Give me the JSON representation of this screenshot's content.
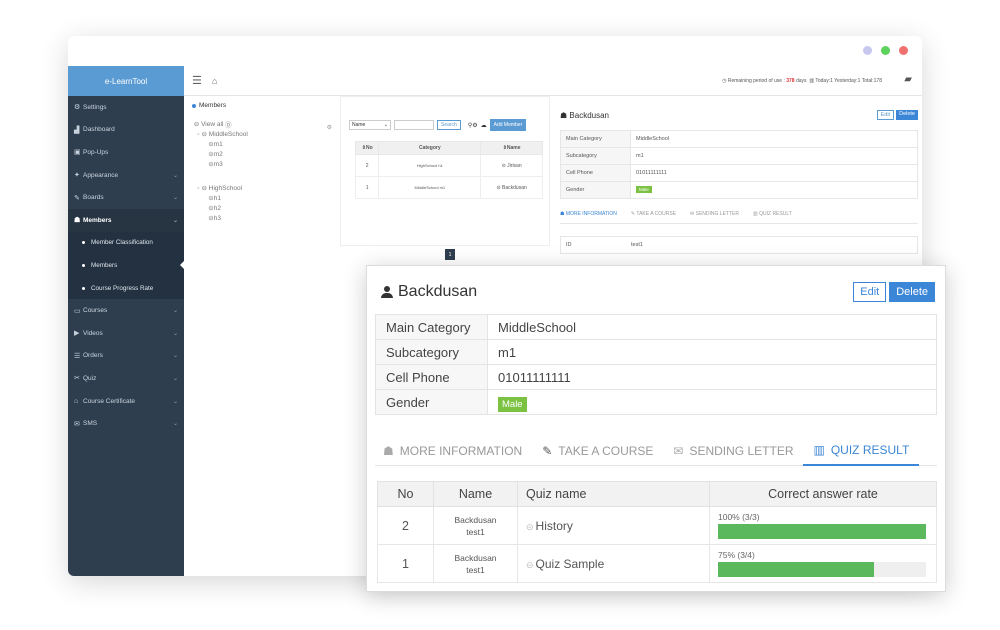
{
  "app": {
    "logo": "e-LearnTool"
  },
  "window_controls": {
    "colors": [
      "#c7c7f0",
      "#5cd15c",
      "#f07070"
    ]
  },
  "topbar": {
    "usage_prefix": "Remaining period of use :",
    "usage_days": "378",
    "usage_suffix": "days",
    "stats": "Today:1  Yesterday:1  Total:178"
  },
  "sidebar": {
    "items": [
      {
        "label": "Settings",
        "icon": "⚙"
      },
      {
        "label": "Dashboard",
        "icon": "▟"
      },
      {
        "label": "Pop-Ups",
        "icon": "▣"
      },
      {
        "label": "Appearance",
        "icon": "✦"
      },
      {
        "label": "Boards",
        "icon": "✎"
      },
      {
        "label": "Members",
        "icon": "☗"
      }
    ],
    "member_sub": [
      "Member Classification",
      "Members",
      "Course Progress Rate"
    ],
    "items2": [
      {
        "label": "Courses",
        "icon": "▭"
      },
      {
        "label": "Videos",
        "icon": "▶"
      },
      {
        "label": "Orders",
        "icon": "☰"
      },
      {
        "label": "Quiz",
        "icon": "✂"
      },
      {
        "label": "Course Certificate",
        "icon": "⌂"
      },
      {
        "label": "SMS",
        "icon": "✉"
      }
    ]
  },
  "tree": {
    "title": "Members",
    "view_all": "View all",
    "groups": [
      {
        "name": "MiddleSchool",
        "children": [
          "m1",
          "m2",
          "m3"
        ]
      },
      {
        "name": "HighSchool",
        "children": [
          "h1",
          "h2",
          "h3"
        ]
      }
    ]
  },
  "member_list": {
    "search_field": "Name",
    "search_label": "Search",
    "add_label": "Add Member",
    "headers": [
      "No",
      "Category",
      "Name"
    ],
    "rows": [
      {
        "no": "2",
        "category": "HighSchool h1",
        "name": "Jirisan"
      },
      {
        "no": "1",
        "category": "MiddleSchool m1",
        "name": "Backdusan"
      }
    ],
    "page": "1"
  },
  "detail": {
    "name": "Backdusan",
    "edit_label": "Edit",
    "delete_label": "Delete",
    "fields": [
      {
        "key": "Main Category",
        "value": "MiddleSchool"
      },
      {
        "key": "Subcategory",
        "value": "m1"
      },
      {
        "key": "Cell Phone",
        "value": "01011111111"
      },
      {
        "key": "Gender",
        "value": "Male"
      }
    ],
    "tabs": [
      "MORE INFORMATION",
      "TAKE A COURSE",
      "SENDING LETTER",
      "QUIZ RESULT"
    ],
    "id_key": "ID",
    "id_value": "test1"
  },
  "quiz_result": {
    "headers": [
      "No",
      "Name",
      "Quiz name",
      "Correct answer rate"
    ],
    "rows": [
      {
        "no": "2",
        "name1": "Backdusan",
        "name2": "test1",
        "quiz": "History",
        "rate_text": "100% (3/3)",
        "rate": 1.0
      },
      {
        "no": "1",
        "name1": "Backdusan",
        "name2": "test1",
        "quiz": "Quiz Sample",
        "rate_text": "75% (3/4)",
        "rate": 0.75
      }
    ]
  }
}
